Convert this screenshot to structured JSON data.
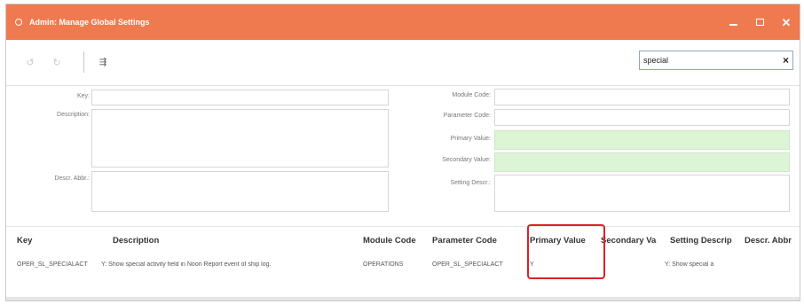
{
  "window": {
    "title": "Admin: Manage Global Settings"
  },
  "toolbar": {
    "search": {
      "value": "special",
      "placeholder": ""
    },
    "clear_label": "×",
    "export_label": "⇶"
  },
  "form": {
    "key_label": "Key:",
    "description_label": "Description:",
    "descr_abbr_label": "Descr. Abbr.:",
    "module_code_label": "Module Code:",
    "parameter_code_label": "Parameter Code:",
    "primary_value_label": "Primary Value:",
    "secondary_value_label": "Secondary Value:",
    "setting_descr_label": "Setting Descr.:"
  },
  "grid": {
    "columns": [
      "Key",
      "Description",
      "Module Code",
      "Parameter Code",
      "Primary Value",
      "Secondary Va",
      "Setting Descrip",
      "Descr. Abbr"
    ],
    "rows": [
      {
        "key": "OPER_SL_SPECIALACT",
        "description": "Y: Show special activity field in Noon Report event of ship log.",
        "module_code": "OPERATIONS",
        "parameter_code": "OPER_SL_SPECIALACT",
        "primary_value": "Y",
        "secondary_value": "",
        "setting_descr": "Y: Show special a",
        "descr_abbr": ""
      }
    ]
  },
  "colors": {
    "titlebar": "#f07a4f",
    "highlight": "#e0202a",
    "green_field": "#dcf5d4"
  }
}
